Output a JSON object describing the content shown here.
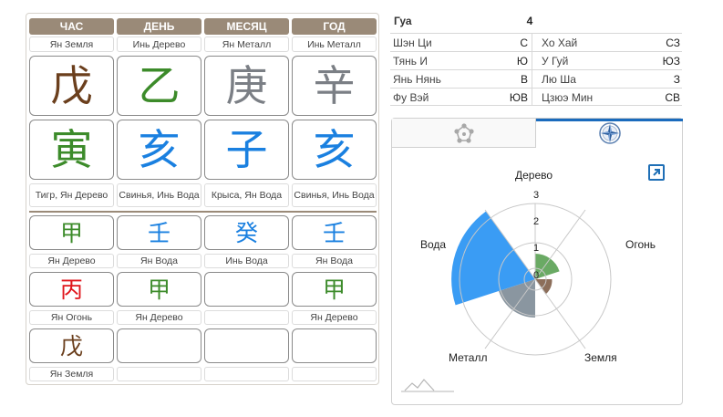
{
  "columns": [
    "ЧАС",
    "ДЕНЬ",
    "МЕСЯЦ",
    "ГОД"
  ],
  "stem_labels": [
    "Ян Земля",
    "Инь Дерево",
    "Ян Металл",
    "Инь Металл"
  ],
  "stems": [
    "戊",
    "乙",
    "庚",
    "辛"
  ],
  "branches": [
    "寅",
    "亥",
    "子",
    "亥"
  ],
  "branch_labels": [
    "Тигр, Ян Дерево",
    "Свинья, Инь Вода",
    "Крыса, Ян Вода",
    "Свинья, Инь Вода"
  ],
  "hidden1": [
    "甲",
    "壬",
    "癸",
    "壬"
  ],
  "hidden1_labels": [
    "Ян Дерево",
    "Ян Вода",
    "Инь Вода",
    "Ян Вода"
  ],
  "hidden2": [
    "丙",
    "甲",
    "",
    "甲"
  ],
  "hidden2_labels": [
    "Ян Огонь",
    "Ян Дерево",
    "",
    "Ян Дерево"
  ],
  "hidden3": [
    "戊",
    "",
    "",
    ""
  ],
  "hidden3_labels": [
    "Ян Земля",
    "",
    "",
    ""
  ],
  "gua": {
    "label": "Гуа",
    "value": "4"
  },
  "directions": [
    {
      "left_name": "Шэн Ци",
      "left_val": "С",
      "right_name": "Хо Хай",
      "right_val": "СЗ"
    },
    {
      "left_name": "Тянь И",
      "left_val": "Ю",
      "right_name": "У Гуй",
      "right_val": "ЮЗ"
    },
    {
      "left_name": "Янь Нянь",
      "left_val": "В",
      "right_name": "Лю Ша",
      "right_val": "З"
    },
    {
      "left_name": "Фу Вэй",
      "left_val": "ЮВ",
      "right_name": "Цзюэ Мин",
      "right_val": "СВ"
    }
  ],
  "tabs": [
    "five-elements-icon",
    "compass-icon"
  ],
  "radar": {
    "labels": {
      "wood": "Дерево",
      "fire": "Огонь",
      "earth": "Земля",
      "metal": "Металл",
      "water": "Вода"
    },
    "scale": [
      "0",
      "1",
      "2",
      "3"
    ]
  },
  "colors": {
    "wood": "#6aaa64",
    "fire": "#e0161c",
    "earth": "#8c6e5a",
    "metal": "#8a96a0",
    "water": "#3a9cf4",
    "header": "#9a8a78",
    "accent": "#1a6bbd"
  }
}
